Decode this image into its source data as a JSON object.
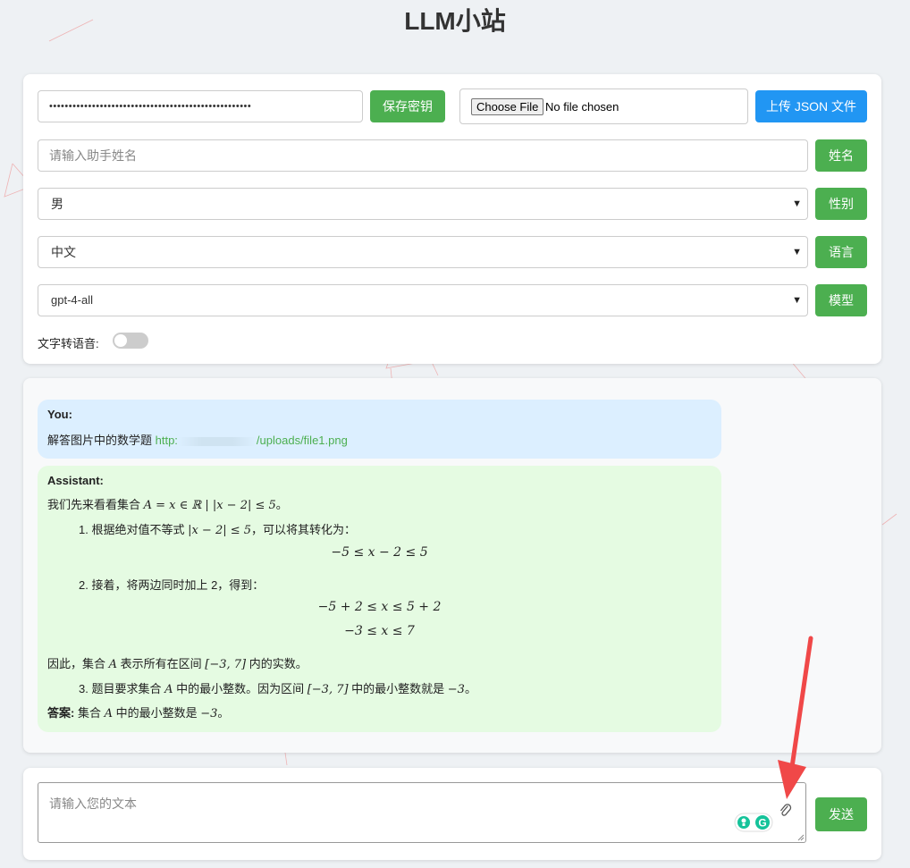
{
  "app": {
    "title": "LLM小站"
  },
  "settings": {
    "api_key_masked": "••••••••••••••••••••••••••••••••••••••••••••••••••••",
    "save_key_label": "保存密钥",
    "file": {
      "choose_label": "Choose File",
      "status": "No file chosen"
    },
    "upload_json_label": "上传 JSON 文件",
    "name_placeholder": "请输入助手姓名",
    "name_button": "姓名",
    "gender_value": "男",
    "gender_button": "性别",
    "language_value": "中文",
    "language_button": "语言",
    "model_value": "gpt-4-all",
    "model_button": "模型",
    "tts_label": "文字转语音:",
    "tts_enabled": false
  },
  "chat": {
    "user": {
      "role": "You:",
      "text": "解答图片中的数学题 ",
      "link_prefix": "http:",
      "link_suffix": "/uploads/file1.png"
    },
    "assistant": {
      "role": "Assistant:",
      "intro_a": "我们先来看看集合 ",
      "intro_math": "A = x ∈ ℝ | |x − 2| ≤ 5",
      "intro_b": "。",
      "step1_a": "1. 根据绝对值不等式 ",
      "step1_math": "|x − 2| ≤ 5",
      "step1_b": "，可以将其转化为：",
      "eq1": "−5 ≤ x − 2 ≤ 5",
      "step2": "2. 接着，将两边同时加上 2，得到：",
      "eq2": "−5 + 2 ≤ x ≤ 5 + 2",
      "eq3": "−3 ≤ x ≤ 7",
      "therefore_a": "因此，集合 ",
      "therefore_var": "A",
      "therefore_b": " 表示所有在区间 ",
      "therefore_interval": "[−3, 7]",
      "therefore_c": " 内的实数。",
      "step3_a": "3. 题目要求集合 ",
      "step3_var": "A",
      "step3_b": " 中的最小整数。因为区间 ",
      "step3_interval": "[−3, 7]",
      "step3_c": " 中的最小整数就是 ",
      "step3_value": "−3",
      "step3_d": "。",
      "answer_label": "答案:",
      "answer_a": " 集合 ",
      "answer_var": "A",
      "answer_b": " 中的最小整数是 ",
      "answer_value": "−3",
      "answer_c": "。"
    }
  },
  "composer": {
    "placeholder": "请输入您的文本",
    "send_label": "发送"
  },
  "colors": {
    "green": "#4caf50",
    "blue": "#2196f3",
    "user_bubble": "#dcefff",
    "assistant_bubble": "#e5fbe2",
    "annotation_arrow": "#f04848"
  }
}
